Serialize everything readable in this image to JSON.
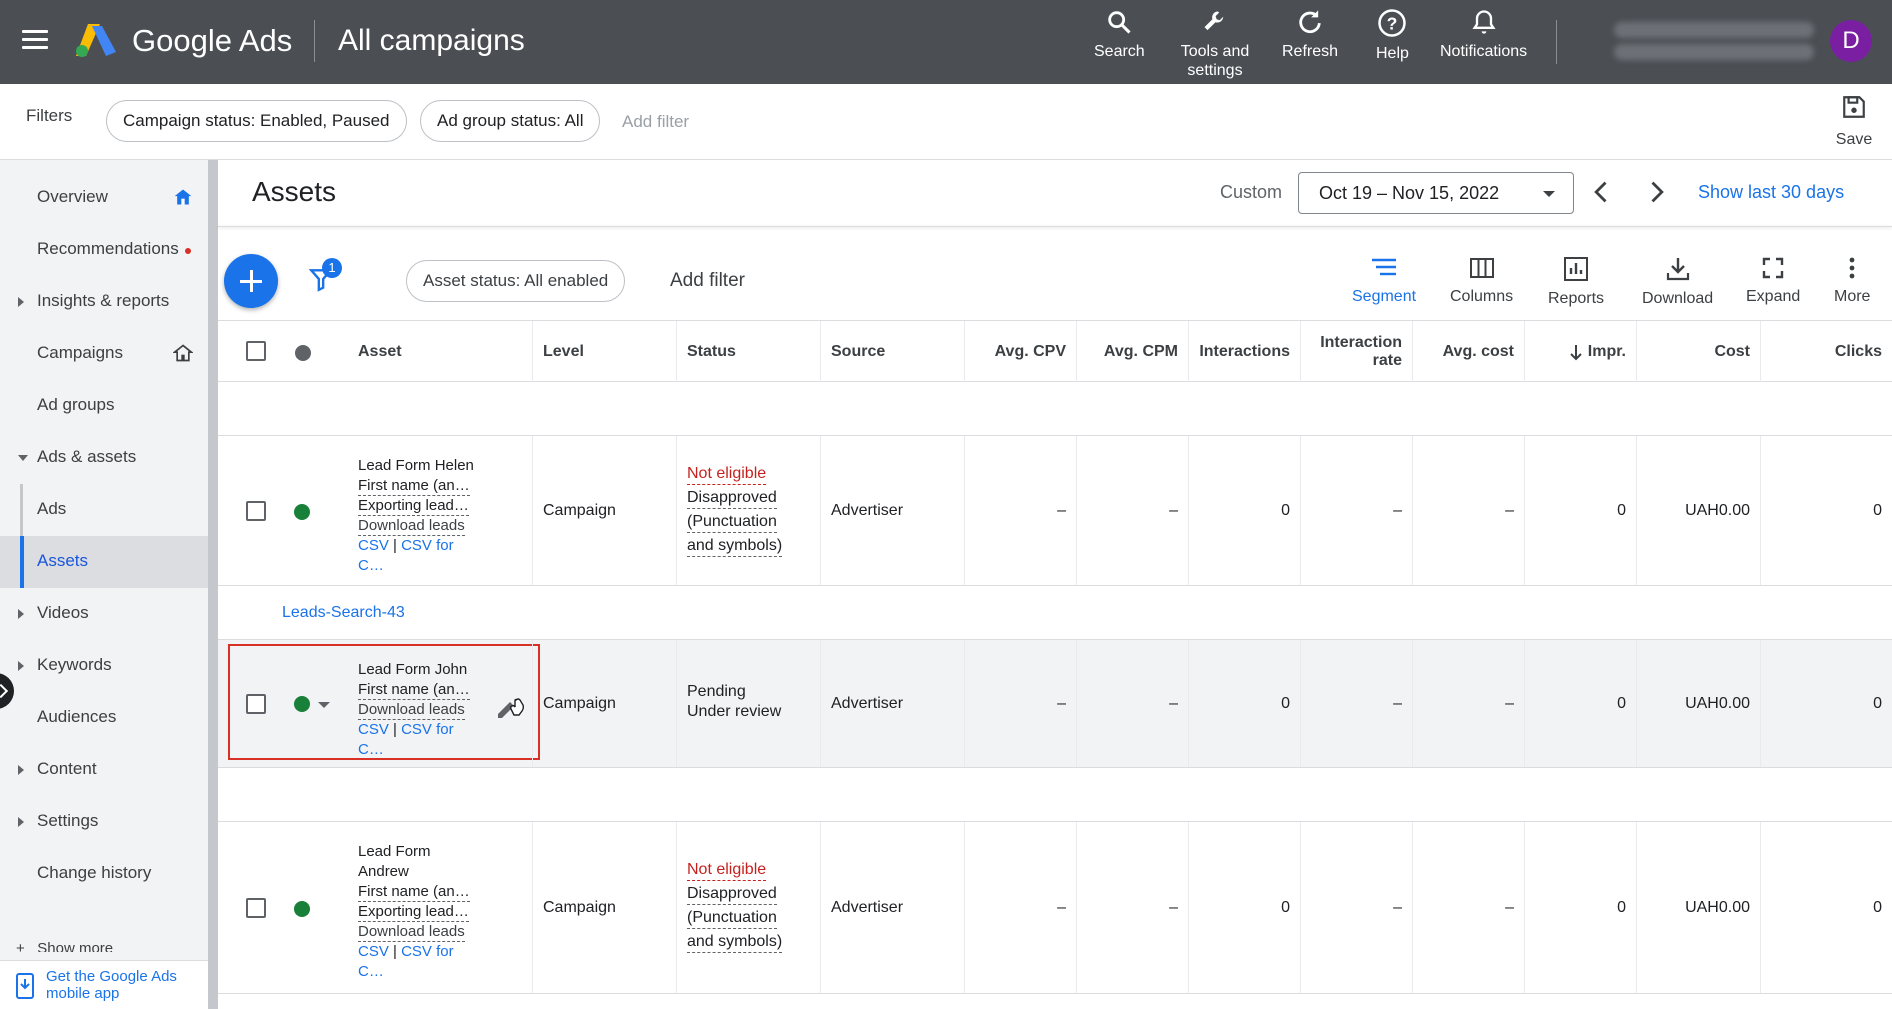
{
  "topbar": {
    "brand": "Google Ads",
    "section": "All campaigns",
    "tools": [
      {
        "label": "Search",
        "icon": "search-icon"
      },
      {
        "label": "Tools and settings",
        "icon": "wrench-icon"
      },
      {
        "label": "Refresh",
        "icon": "refresh-icon"
      },
      {
        "label": "Help",
        "icon": "help-icon"
      },
      {
        "label": "Notifications",
        "icon": "bell-icon"
      }
    ],
    "avatar_letter": "D"
  },
  "filters": {
    "label": "Filters",
    "chips": [
      "Campaign status: Enabled, Paused",
      "Ad group status: All"
    ],
    "add_filter": "Add filter",
    "save": "Save"
  },
  "sidebar": {
    "items": [
      {
        "label": "Overview"
      },
      {
        "label": "Recommendations"
      },
      {
        "label": "Insights & reports"
      },
      {
        "label": "Campaigns"
      },
      {
        "label": "Ad groups"
      },
      {
        "label": "Ads & assets"
      },
      {
        "label": "Ads"
      },
      {
        "label": "Assets"
      },
      {
        "label": "Videos"
      },
      {
        "label": "Keywords"
      },
      {
        "label": "Audiences"
      },
      {
        "label": "Content"
      },
      {
        "label": "Settings"
      },
      {
        "label": "Change history"
      }
    ],
    "show_more": "Show more",
    "app_promo": "Get the Google Ads mobile app"
  },
  "main": {
    "title": "Assets",
    "custom_label": "Custom",
    "date_range": "Oct 19 – Nov 15, 2022",
    "show_last": "Show last 30 days",
    "filter_badge": "1",
    "asset_status_chip": "Asset status: All enabled",
    "add_filter": "Add filter",
    "toolbar": [
      {
        "label": "Segment"
      },
      {
        "label": "Columns"
      },
      {
        "label": "Reports"
      },
      {
        "label": "Download"
      },
      {
        "label": "Expand"
      },
      {
        "label": "More"
      }
    ]
  },
  "table": {
    "columns": {
      "asset": "Asset",
      "level": "Level",
      "status": "Status",
      "source": "Source",
      "avg_cpv": "Avg. CPV",
      "avg_cpm": "Avg. CPM",
      "interactions": "Interactions",
      "interaction_rate": "Interaction rate",
      "avg_cost": "Avg. cost",
      "impr": "Impr.",
      "cost": "Cost",
      "clicks": "Clicks"
    },
    "group_label": "Leads-Search-43",
    "rows": [
      {
        "name": "Lead Form Helen",
        "line2": "First name (an…",
        "line3": "Exporting lead…",
        "download": "Download leads",
        "csv": "CSV",
        "sep": "|",
        "csv_for": "CSV for C…",
        "level": "Campaign",
        "status1": "Not eligible",
        "status2": "Disapproved",
        "status3": "(Punctuation",
        "status4": "and symbols)",
        "source": "Advertiser",
        "avg_cpv": "–",
        "avg_cpm": "–",
        "interactions": "0",
        "interaction_rate": "–",
        "avg_cost": "–",
        "impr": "0",
        "cost": "UAH0.00",
        "clicks": "0"
      },
      {
        "name": "Lead Form John",
        "line2": "First name (an…",
        "download": "Download leads",
        "csv": "CSV",
        "sep": "|",
        "csv_for": "CSV for C…",
        "level": "Campaign",
        "status1": "Pending",
        "status2": "Under review",
        "source": "Advertiser",
        "avg_cpv": "–",
        "avg_cpm": "–",
        "interactions": "0",
        "interaction_rate": "–",
        "avg_cost": "–",
        "impr": "0",
        "cost": "UAH0.00",
        "clicks": "0"
      },
      {
        "name": "Lead Form",
        "name2": "Andrew",
        "line2": "First name (an…",
        "line3": "Exporting lead…",
        "download": "Download leads",
        "csv": "CSV",
        "sep": "|",
        "csv_for": "CSV for C…",
        "level": "Campaign",
        "status1": "Not eligible",
        "status2": "Disapproved",
        "status3": "(Punctuation",
        "status4": "and symbols)",
        "source": "Advertiser",
        "avg_cpv": "–",
        "avg_cpm": "–",
        "interactions": "0",
        "interaction_rate": "–",
        "avg_cost": "–",
        "impr": "0",
        "cost": "UAH0.00",
        "clicks": "0"
      }
    ]
  },
  "colors": {
    "topbar": "#4b4f54",
    "accent": "#1a73e8",
    "enabled_dot": "#188038",
    "error_text": "#c5221f",
    "selection_outline": "#d93025"
  }
}
